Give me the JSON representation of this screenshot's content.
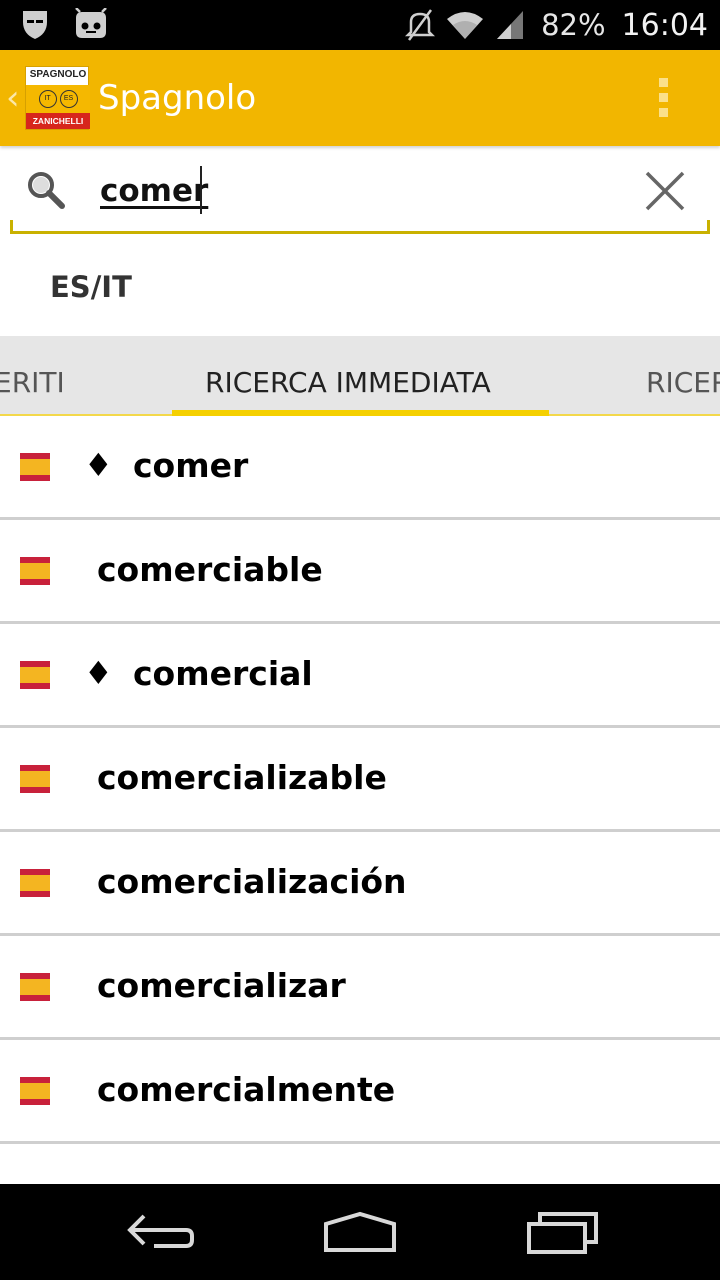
{
  "status_bar": {
    "battery": "82%",
    "time": "16:04",
    "icons": [
      "shield-icon",
      "android-icon",
      "mute-icon",
      "wifi-icon",
      "signal-icon"
    ]
  },
  "action_bar": {
    "title": "Spagnolo",
    "logo": {
      "top": "SPAGNOLO",
      "left_badge": "IT",
      "right_badge": "ES",
      "bottom": "ZANICHELLI"
    },
    "back_glyph": "‹",
    "overflow_icon": "overflow-menu-icon"
  },
  "search": {
    "value": "comer",
    "icon": "search-icon",
    "clear_icon": "close-icon"
  },
  "language": "ES/IT",
  "tabs": [
    {
      "label": "ERITI"
    },
    {
      "label": "RICERCA IMMEDIATA"
    },
    {
      "label": "RICER"
    }
  ],
  "results": [
    {
      "word": "comer",
      "marker": "♦"
    },
    {
      "word": "comerciable",
      "marker": ""
    },
    {
      "word": "comercial",
      "marker": "♦"
    },
    {
      "word": "comercializable",
      "marker": ""
    },
    {
      "word": "comercialización",
      "marker": ""
    },
    {
      "word": "comercializar",
      "marker": ""
    },
    {
      "word": "comercialmente",
      "marker": ""
    }
  ],
  "colors": {
    "accent": "#f2b600",
    "tab_indicator": "#f5d000",
    "search_underline": "#c9b100",
    "flag_red": "#c8213b",
    "flag_yellow": "#f4b521"
  }
}
